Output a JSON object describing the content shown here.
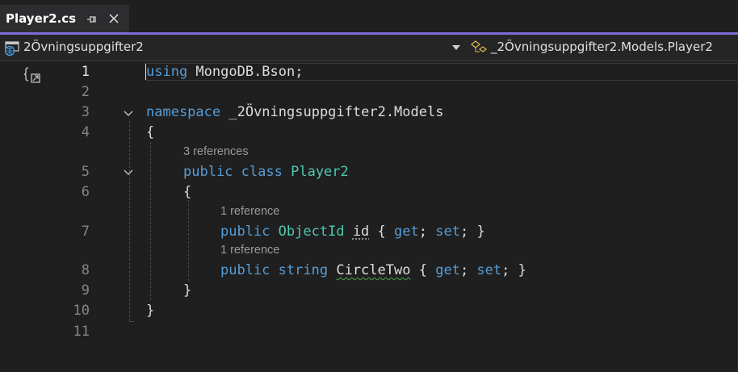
{
  "tab": {
    "title": "Player2.cs"
  },
  "navbar": {
    "project": "2Övningsuppgifter2",
    "class_path": "_2Övningsuppgifter2.Models.Player2"
  },
  "colors": {
    "accent": "#7f6ad6",
    "keyword": "#569cd6",
    "type": "#4ec9b0",
    "text": "#dcdcdc",
    "line_number": "#858585"
  },
  "icons": [
    "pin-icon",
    "close-icon",
    "project-icon",
    "chevron-down-icon",
    "class-icon",
    "codelens-icon",
    "fold-chevron-icon"
  ],
  "editor": {
    "line_numbers": [
      "1",
      "2",
      "3",
      "4",
      "5",
      "6",
      "7",
      "8",
      "9",
      "10",
      "11"
    ],
    "line1": {
      "kw": "using",
      "rest": " MongoDB.Bson;"
    },
    "line3": {
      "kw": "namespace",
      "rest": " _2Övningsuppgifter2.Models"
    },
    "line4": {
      "text": "{"
    },
    "lens5": "3 references",
    "line5": {
      "kw1": "public",
      "kw2": "class",
      "type": "Player2"
    },
    "line6": {
      "text": "{"
    },
    "lens7": "1 reference",
    "line7": {
      "kw1": "public",
      "type": "ObjectId",
      "name": "id",
      "open": "{",
      "get": "get",
      "set": "set",
      "close": "}"
    },
    "lens8": "1 reference",
    "line8": {
      "kw1": "public",
      "kw2": "string",
      "name": "CircleTwo",
      "open": "{",
      "get": "get",
      "set": "set",
      "close": "}"
    },
    "line9": {
      "text": "}"
    },
    "line10": {
      "text": "}"
    }
  }
}
